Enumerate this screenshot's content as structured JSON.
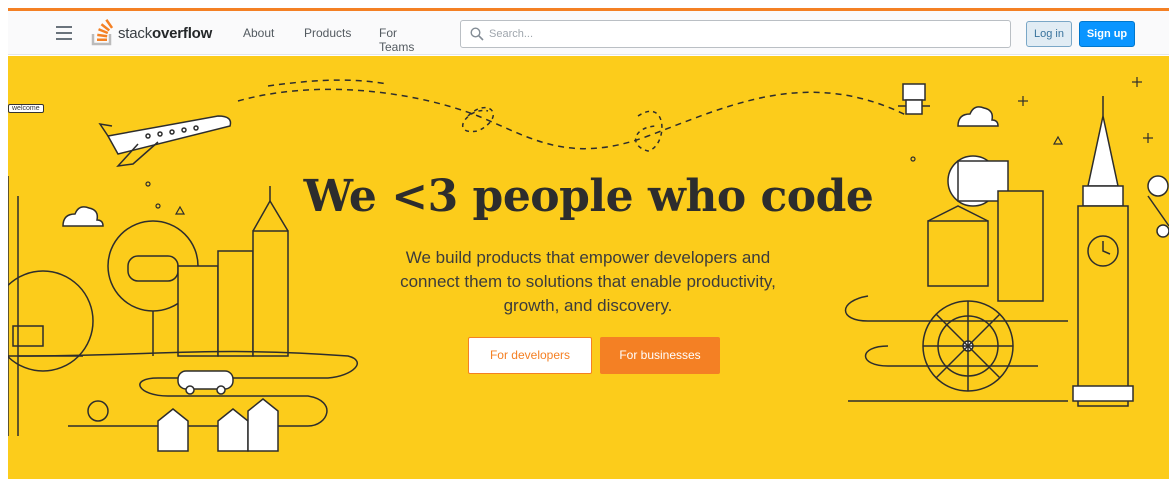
{
  "header": {
    "logo": {
      "text_light": "stack",
      "text_bold": "overflow"
    },
    "nav": [
      {
        "label": "About"
      },
      {
        "label": "Products"
      },
      {
        "label": "For Teams"
      }
    ],
    "search": {
      "placeholder": "Search..."
    },
    "login_label": "Log in",
    "signup_label": "Sign up",
    "icons": {
      "menu": "hamburger-icon",
      "search": "search-icon",
      "logo": "stackoverflow-logo-icon"
    }
  },
  "hero": {
    "headline": "We <3 people who code",
    "subtitle": "We build products that empower developers and connect them to solutions that enable productivity, growth, and discovery.",
    "buttons": {
      "developers": "For developers",
      "businesses": "For businesses"
    },
    "tag_welcome": "welcome",
    "colors": {
      "background": "#fccc1b",
      "accent": "#f48024",
      "blue": "#0a95ff"
    }
  }
}
